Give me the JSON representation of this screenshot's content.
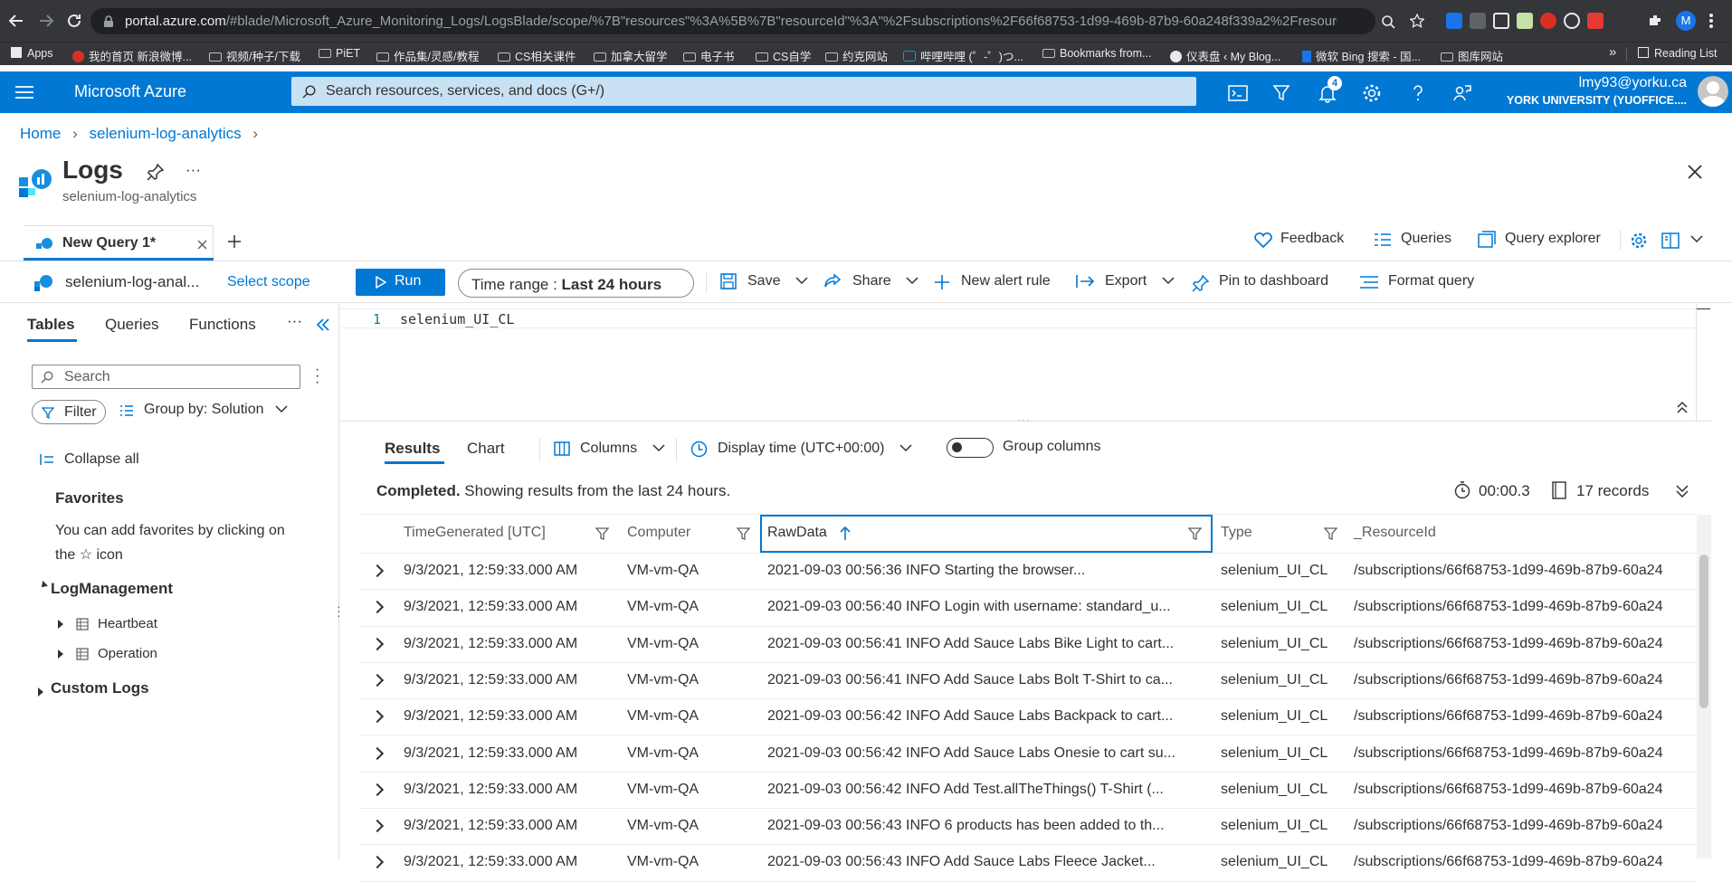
{
  "browser": {
    "url_host": "portal.azure.com",
    "url_path": "/#blade/Microsoft_Azure_Monitoring_Logs/LogsBlade/scope/%7B\"resources\"%3A%5B%7B\"resourceId\"%3A\"%2Fsubscriptions%2F66f68753-1d99-469b-87b9-60a248f339a2%2Fresourc...",
    "bookmarks": [
      "Apps",
      "我的首页 新浪微博...",
      "视频/种子/下载",
      "PiET",
      "作品集/灵感/教程",
      "CS相关课件",
      "加拿大留学",
      "电子书",
      "CS自学",
      "约克网站",
      "哔哩哔哩 (゜-゜)つ...",
      "Bookmarks from...",
      "仪表盘 ‹ My Blog...",
      "微软 Bing 搜索 - 国...",
      "图库网站"
    ],
    "more_label": "»",
    "reading_list": "Reading List"
  },
  "azure": {
    "brand": "Microsoft Azure",
    "search_placeholder": "Search resources, services, and docs (G+/)",
    "notification_count": "4",
    "user_email": "lmy93@yorku.ca",
    "user_org": "YORK UNIVERSITY (YUOFFICE...."
  },
  "breadcrumb": {
    "home": "Home",
    "resource": "selenium-log-analytics"
  },
  "blade": {
    "title": "Logs",
    "subtitle": "selenium-log-analytics",
    "more": "···"
  },
  "tab": {
    "label": "New Query 1*"
  },
  "top_actions": {
    "feedback": "Feedback",
    "queries": "Queries",
    "query_explorer": "Query explorer"
  },
  "toolbar": {
    "scope_name": "selenium-log-anal...",
    "select_scope": "Select scope",
    "run": "Run",
    "time_range_label": "Time range :",
    "time_range_value": "Last 24 hours",
    "save": "Save",
    "share": "Share",
    "new_alert": "New alert rule",
    "export": "Export",
    "pin": "Pin to dashboard",
    "format": "Format query"
  },
  "side_panel": {
    "tabs": [
      "Tables",
      "Queries",
      "Functions"
    ],
    "search_placeholder": "Search",
    "filter": "Filter",
    "group_by": "Group by: Solution",
    "collapse_all": "Collapse all",
    "favorites_title": "Favorites",
    "favorites_hint_1": "You can add favorites by clicking on",
    "favorites_hint_2": "the ☆ icon",
    "log_management": "LogManagement",
    "tables": [
      "Heartbeat",
      "Operation"
    ],
    "custom_logs": "Custom Logs"
  },
  "editor": {
    "line_number": "1",
    "query": "selenium_UI_CL"
  },
  "results": {
    "tabs": [
      "Results",
      "Chart"
    ],
    "columns_label": "Columns",
    "display_time": "Display time (UTC+00:00)",
    "group_columns": "Group columns",
    "status_bold": "Completed.",
    "status_text": "Showing results from the last 24 hours.",
    "duration": "00:00.3",
    "records": "17 records",
    "headers": [
      "TimeGenerated [UTC]",
      "Computer",
      "RawData",
      "Type",
      "_ResourceId"
    ],
    "rows": [
      [
        "9/3/2021, 12:59:33.000 AM",
        "VM-vm-QA",
        "2021-09-03 00:56:36 INFO Starting the browser...",
        "selenium_UI_CL",
        "/subscriptions/66f68753-1d99-469b-87b9-60a24"
      ],
      [
        "9/3/2021, 12:59:33.000 AM",
        "VM-vm-QA",
        "2021-09-03 00:56:40 INFO Login with username: standard_u...",
        "selenium_UI_CL",
        "/subscriptions/66f68753-1d99-469b-87b9-60a24"
      ],
      [
        "9/3/2021, 12:59:33.000 AM",
        "VM-vm-QA",
        "2021-09-03 00:56:41 INFO Add Sauce Labs Bike Light to cart...",
        "selenium_UI_CL",
        "/subscriptions/66f68753-1d99-469b-87b9-60a24"
      ],
      [
        "9/3/2021, 12:59:33.000 AM",
        "VM-vm-QA",
        "2021-09-03 00:56:41 INFO Add Sauce Labs Bolt T-Shirt to ca...",
        "selenium_UI_CL",
        "/subscriptions/66f68753-1d99-469b-87b9-60a24"
      ],
      [
        "9/3/2021, 12:59:33.000 AM",
        "VM-vm-QA",
        "2021-09-03 00:56:42 INFO Add Sauce Labs Backpack to cart...",
        "selenium_UI_CL",
        "/subscriptions/66f68753-1d99-469b-87b9-60a24"
      ],
      [
        "9/3/2021, 12:59:33.000 AM",
        "VM-vm-QA",
        "2021-09-03 00:56:42 INFO Add Sauce Labs Onesie to cart su...",
        "selenium_UI_CL",
        "/subscriptions/66f68753-1d99-469b-87b9-60a24"
      ],
      [
        "9/3/2021, 12:59:33.000 AM",
        "VM-vm-QA",
        "2021-09-03 00:56:42 INFO Add Test.allTheThings() T-Shirt (...",
        "selenium_UI_CL",
        "/subscriptions/66f68753-1d99-469b-87b9-60a24"
      ],
      [
        "9/3/2021, 12:59:33.000 AM",
        "VM-vm-QA",
        "2021-09-03 00:56:43 INFO 6 products has been added to th...",
        "selenium_UI_CL",
        "/subscriptions/66f68753-1d99-469b-87b9-60a24"
      ],
      [
        "9/3/2021, 12:59:33.000 AM",
        "VM-vm-QA",
        "2021-09-03 00:56:43 INFO Add Sauce Labs Fleece Jacket...",
        "selenium_UI_CL",
        "/subscriptions/66f68753-1d99-469b-87b9-60a24"
      ]
    ]
  },
  "colors": {
    "azure_blue": "#0078d4",
    "chrome_dark": "#35363a"
  }
}
